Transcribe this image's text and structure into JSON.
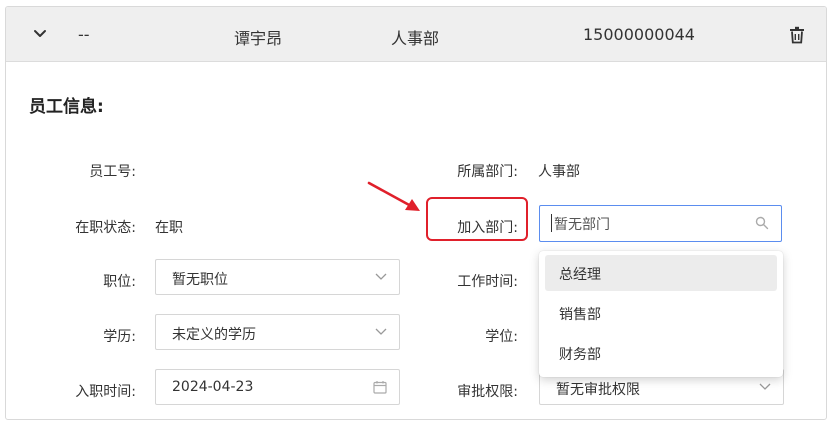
{
  "header": {
    "col1": "--",
    "name": "谭宇昂",
    "department": "人事部",
    "phone": "15000000044"
  },
  "section_title": "员工信息:",
  "fields": {
    "employee_no_label": "员工号:",
    "employee_no_value": "",
    "dept_label": "所属部门:",
    "dept_value": "人事部",
    "status_label": "在职状态:",
    "status_value": "在职",
    "join_dept_label": "加入部门:",
    "join_dept_value": "暂无部门",
    "position_label": "职位:",
    "position_value": "暂无职位",
    "work_time_label": "工作时间:",
    "education_label": "学历:",
    "education_value": "未定义的学历",
    "degree_label": "学位:",
    "hire_date_label": "入职时间:",
    "hire_date_value": "2024-04-23",
    "approval_label": "审批权限:",
    "approval_value": "暂无审批权限"
  },
  "dropdown": {
    "options": [
      "总经理",
      "销售部",
      "财务部"
    ],
    "highlighted_index": 0
  },
  "colors": {
    "highlight": "#e0202b",
    "focus_border": "#5b8def",
    "header_bg": "#efefef"
  },
  "icons": {
    "expand": "chevron-down-icon",
    "delete": "trash-icon",
    "search": "search-icon",
    "calendar": "calendar-icon",
    "annotation": "red-arrow-icon"
  }
}
